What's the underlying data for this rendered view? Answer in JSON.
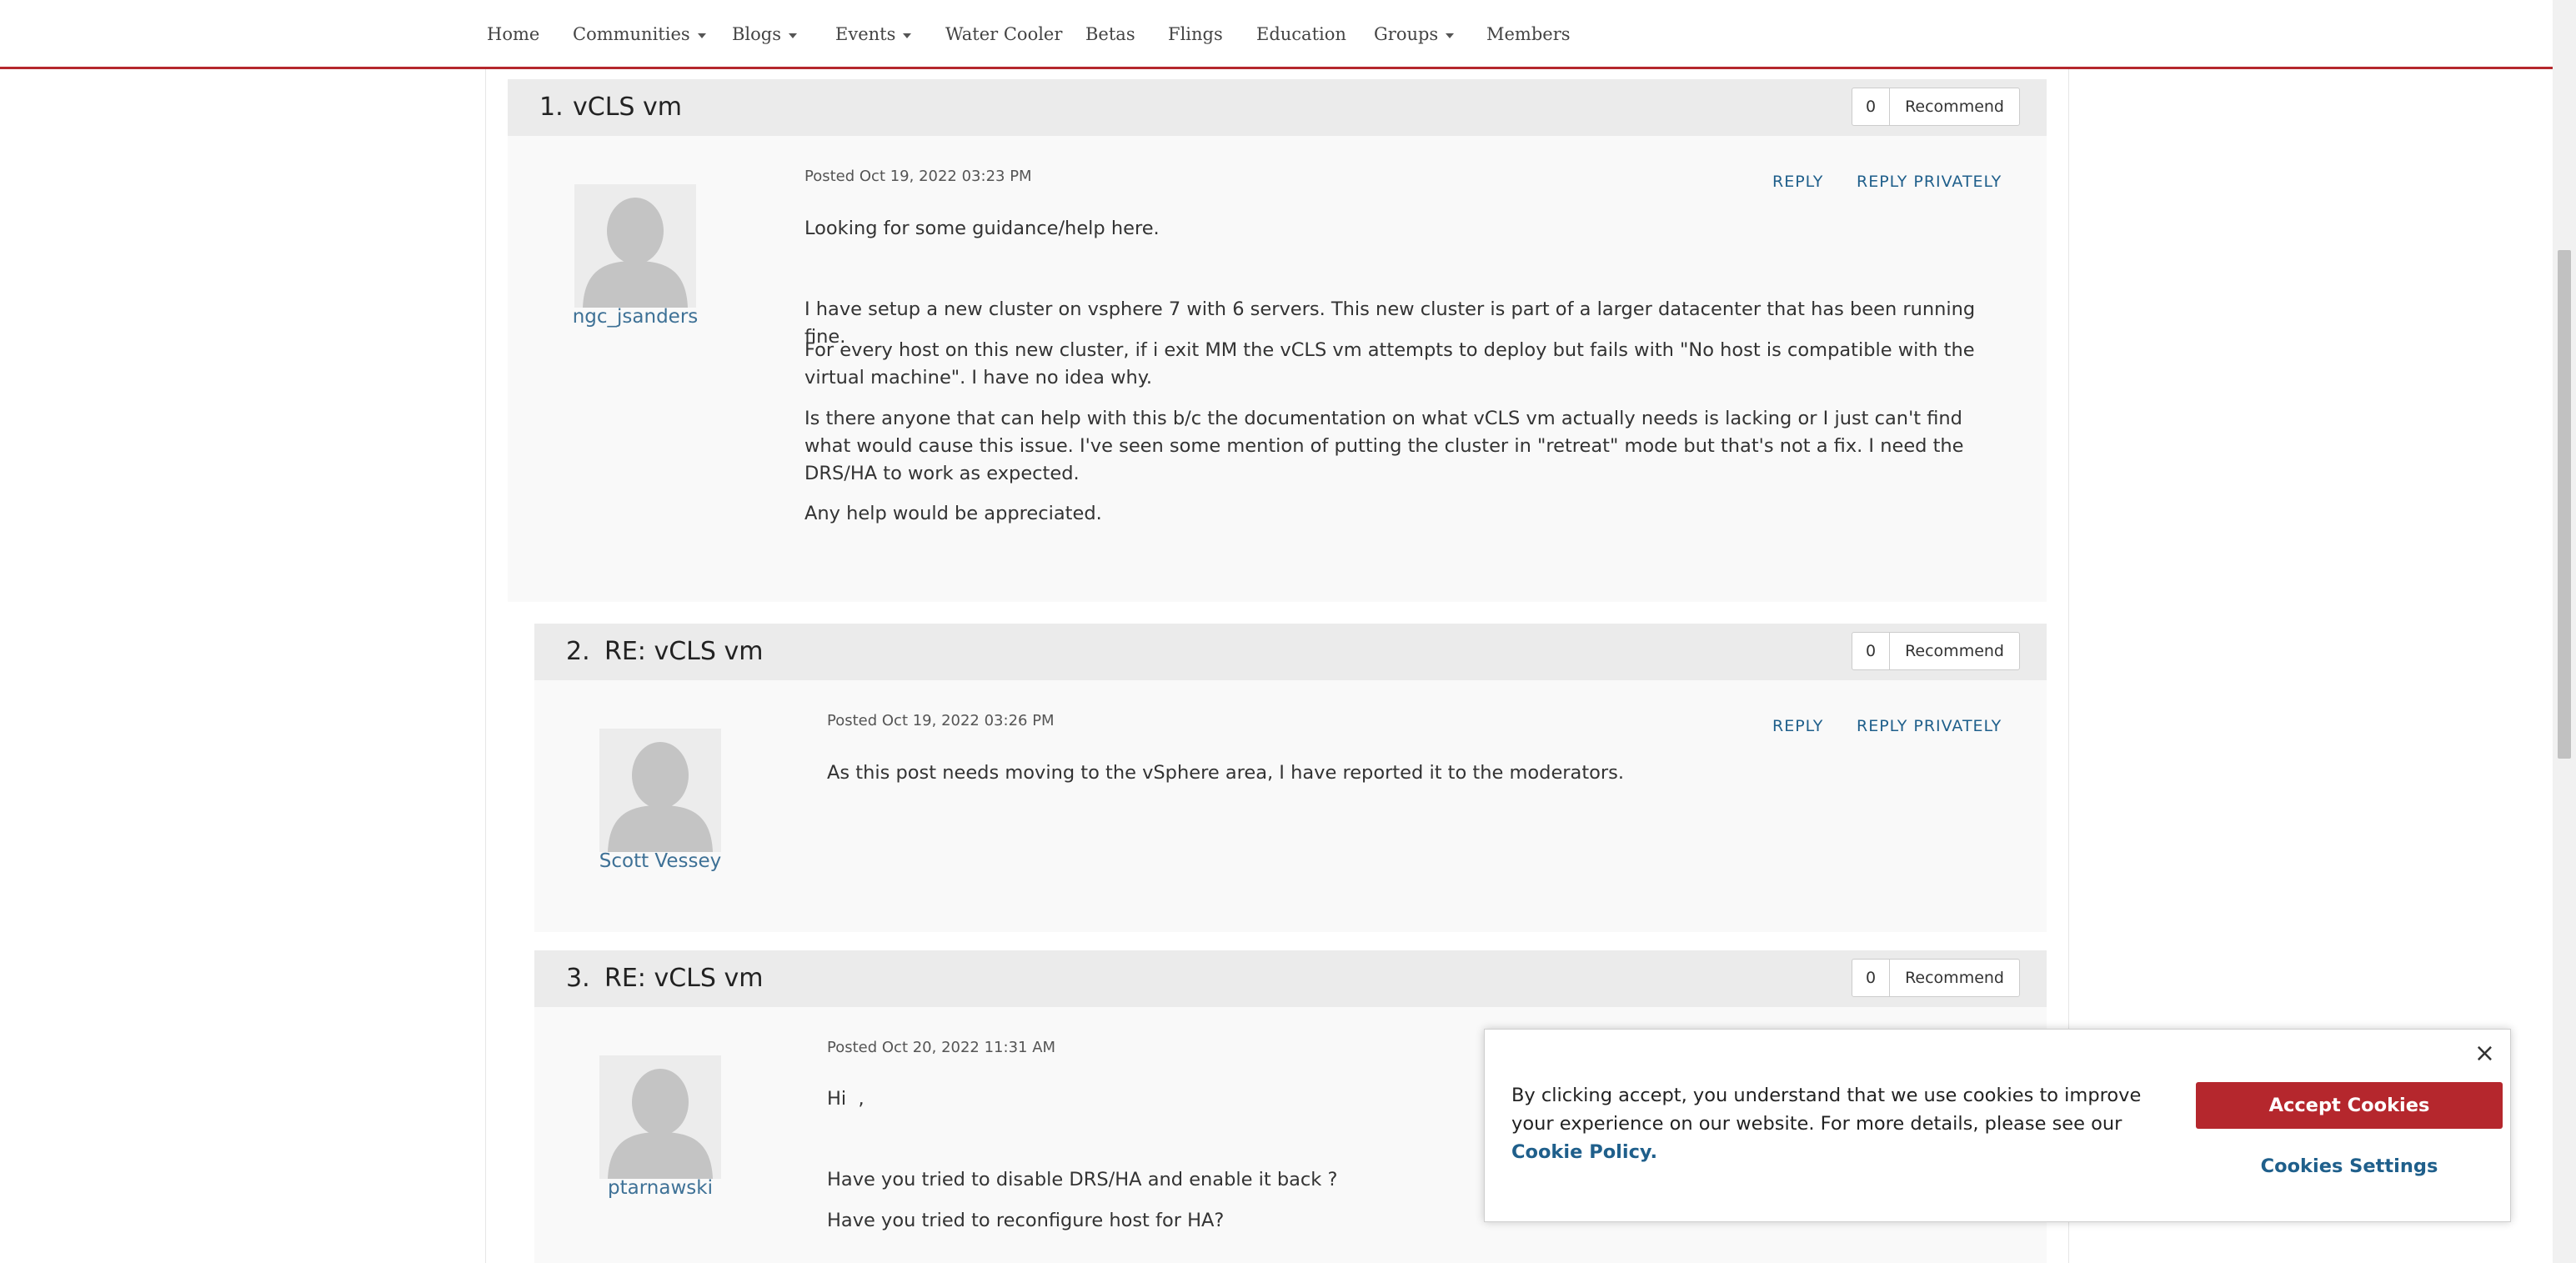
{
  "nav": {
    "items": [
      {
        "label": "Home",
        "dropdown": false
      },
      {
        "label": "Communities",
        "dropdown": true
      },
      {
        "label": "Blogs",
        "dropdown": true
      },
      {
        "label": "Events",
        "dropdown": true
      },
      {
        "label": "Water Cooler",
        "dropdown": false
      },
      {
        "label": "Betas",
        "dropdown": false
      },
      {
        "label": "Flings",
        "dropdown": false
      },
      {
        "label": "Education",
        "dropdown": false
      },
      {
        "label": "Groups",
        "dropdown": true
      },
      {
        "label": "Members",
        "dropdown": false
      }
    ]
  },
  "posts": [
    {
      "number": "1.",
      "title": "vCLS vm",
      "recommend_count": "0",
      "recommend_label": "Recommend",
      "author": "ngc_jsanders",
      "posted": "Posted Oct 19, 2022 03:23 PM",
      "reply_label": "REPLY",
      "reply_privately_label": "REPLY PRIVATELY",
      "paragraphs": [
        "Looking for some guidance/help here.",
        "I have setup a new cluster on vsphere 7 with 6 servers. This new cluster is part of a larger datacenter that has been running fine.",
        "For every host on this new cluster, if i exit MM the vCLS vm attempts to deploy but fails with \"No host is compatible with the virtual machine\". I have no idea why.",
        "Is there anyone that can help with this b/c the documentation on what vCLS vm actually needs is lacking or I just can't find what would cause this issue. I've seen some mention of putting the cluster in \"retreat\" mode but that's not a fix. I need the DRS/HA to work as expected.",
        "Any help would be appreciated."
      ]
    },
    {
      "number": "2.",
      "title": "RE: vCLS vm",
      "recommend_count": "0",
      "recommend_label": "Recommend",
      "author": "Scott Vessey",
      "posted": "Posted Oct 19, 2022 03:26 PM",
      "reply_label": "REPLY",
      "reply_privately_label": "REPLY PRIVATELY",
      "paragraphs": [
        "As this post needs moving to the vSphere area, I have reported it to the moderators."
      ]
    },
    {
      "number": "3.",
      "title": "RE: vCLS vm",
      "recommend_count": "0",
      "recommend_label": "Recommend",
      "author": "ptarnawski",
      "posted": "Posted Oct 20, 2022 11:31 AM",
      "paragraphs": [
        "Hi  ,",
        "Have you tried to disable DRS/HA and enable it back ?",
        "Have you tried to reconfigure host for HA?"
      ]
    }
  ],
  "cookie_banner": {
    "text": "By clicking accept, you understand that we use cookies to improve your experience on our website. For more details, please see our",
    "link_label": "Cookie Policy.",
    "accept_label": "Accept Cookies",
    "settings_label": "Cookies Settings",
    "close_icon": "×"
  },
  "colors": {
    "brand_red": "#b5272d",
    "link_blue": "#1f5f8b",
    "author_blue": "#3e7196"
  }
}
